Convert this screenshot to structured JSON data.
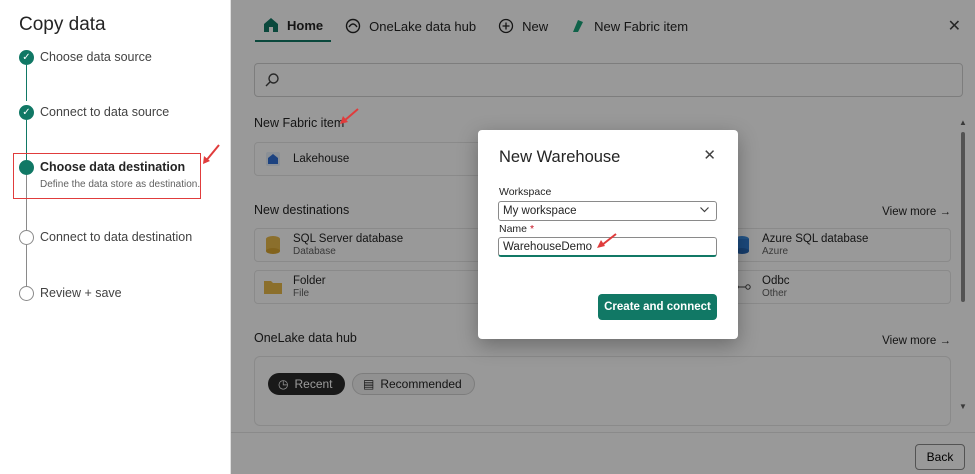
{
  "wizard": {
    "title": "Copy data",
    "steps": [
      {
        "label": "Choose data source",
        "state": "done"
      },
      {
        "label": "Connect to data source",
        "state": "done"
      },
      {
        "label": "Choose data destination",
        "sublabel": "Define the data store as destination.",
        "state": "current"
      },
      {
        "label": "Connect to data destination",
        "state": "todo"
      },
      {
        "label": "Review + save",
        "state": "todo"
      }
    ]
  },
  "tabs": [
    {
      "label": "Home",
      "icon": "home-icon",
      "active": true
    },
    {
      "label": "OneLake data hub",
      "icon": "onelake-icon"
    },
    {
      "label": "New",
      "icon": "plus-circle-icon"
    },
    {
      "label": "New Fabric item",
      "icon": "fabric-icon"
    }
  ],
  "sections": {
    "new_fabric_item": "New Fabric item",
    "new_destinations": "New destinations",
    "onelake_hub": "OneLake data hub",
    "view_more": "View more"
  },
  "cards": {
    "lakehouse": {
      "title": "Lakehouse"
    },
    "sql_server": {
      "title": "SQL Server database",
      "sub": "Database"
    },
    "azure_sql": {
      "title": "Azure SQL database",
      "sub": "Azure"
    },
    "folder": {
      "title": "Folder",
      "sub": "File"
    },
    "odbc": {
      "title": "Odbc",
      "sub": "Other"
    }
  },
  "hub_pills": {
    "recent": "Recent",
    "recommended": "Recommended"
  },
  "back_button": "Back",
  "dialog": {
    "title": "New Warehouse",
    "workspace_label": "Workspace",
    "workspace_value": "My workspace",
    "name_label": "Name",
    "name_required": "*",
    "name_value": "WarehouseDemo",
    "create_button": "Create and connect"
  },
  "colors": {
    "accent": "#117865",
    "annotation": "#e03c3c"
  }
}
